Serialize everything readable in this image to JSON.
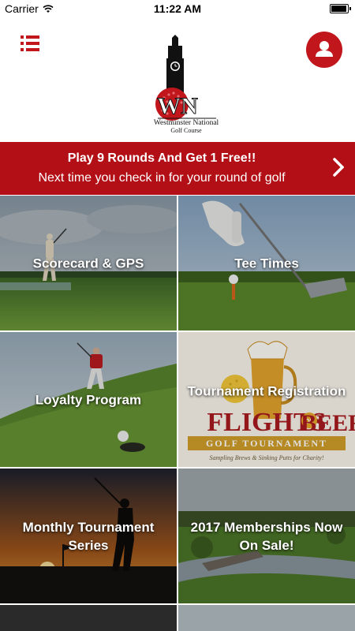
{
  "status_bar": {
    "carrier": "Carrier",
    "time": "11:22 AM",
    "battery_level": 0.95
  },
  "header": {
    "menu_icon": "list-icon",
    "profile_icon": "user-icon",
    "logo": {
      "name_line1": "Westminster National",
      "name_line2": "Golf Course",
      "monogram": "WN"
    }
  },
  "promo": {
    "title": "Play 9 Rounds And Get 1 Free!!",
    "subtitle": "Next time you check in for your round of golf",
    "icon": "chevron-right-icon"
  },
  "tiles": [
    {
      "label": "Scorecard & GPS"
    },
    {
      "label": "Tee Times"
    },
    {
      "label": "Loyalty Program"
    },
    {
      "label": "Tournament Registration",
      "poster": {
        "line1": "FLIGHTS",
        "of": "OF",
        "line2": "BEER",
        "banner": "GOLF TOURNAMENT",
        "tagline": "Sampling Brews & Sinking Putts for Charity!"
      }
    },
    {
      "label": "Monthly Tournament Series"
    },
    {
      "label": "2017 Memberships Now On Sale!"
    }
  ],
  "colors": {
    "accent": "#c0161c",
    "promo_bg": "#b30f16"
  }
}
